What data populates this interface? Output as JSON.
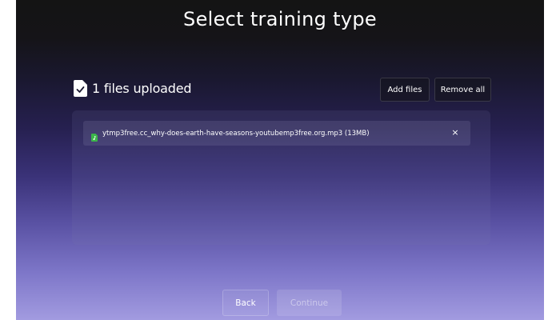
{
  "page": {
    "title": "Select training type"
  },
  "upload": {
    "header_text": "1 files uploaded",
    "icon": "document-check-icon",
    "add_label": "Add files",
    "remove_all_label": "Remove all"
  },
  "files": [
    {
      "name": "ytmp3free.cc_why-does-earth-have-seasons-youtubemp3free.org.mp3 (13MB)",
      "icon": "audio-file-icon",
      "icon_color": "#3bb54a",
      "remove_label": "×"
    }
  ],
  "footer": {
    "back_label": "Back",
    "continue_label": "Continue",
    "continue_disabled": true
  }
}
